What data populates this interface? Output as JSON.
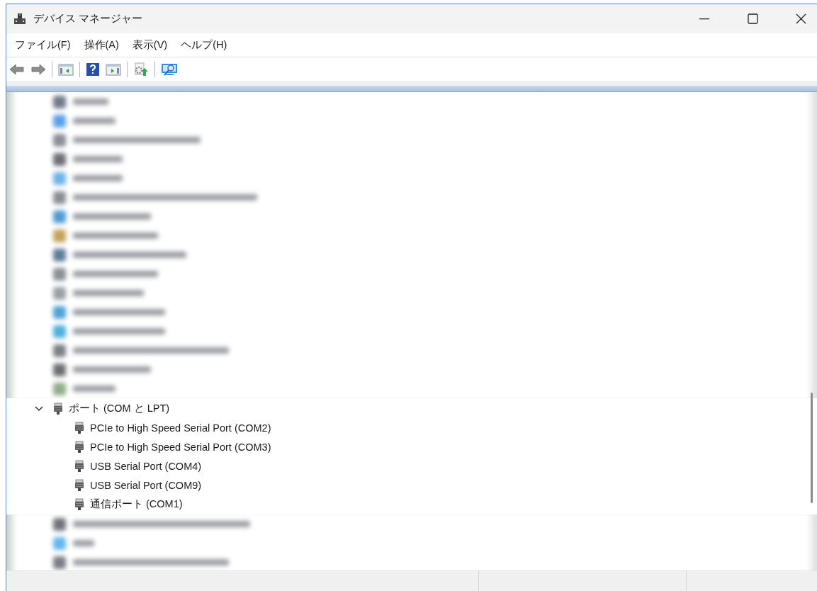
{
  "window": {
    "title": "デバイス マネージャー"
  },
  "menu": [
    {
      "label": "ファイル(F)"
    },
    {
      "label": "操作(A)"
    },
    {
      "label": "表示(V)"
    },
    {
      "label": "ヘルプ(H)"
    }
  ],
  "tree": [
    {
      "label": "ポート (COM と LPT)",
      "expanded": true,
      "children": [
        {
          "label": "PCIe to High Speed Serial Port (COM2)"
        },
        {
          "label": "PCIe to High Speed Serial Port (COM3)"
        },
        {
          "label": "USB Serial Port (COM4)"
        },
        {
          "label": "USB Serial Port (COM9)"
        },
        {
          "label": "通信ポート (COM1)"
        }
      ]
    }
  ]
}
